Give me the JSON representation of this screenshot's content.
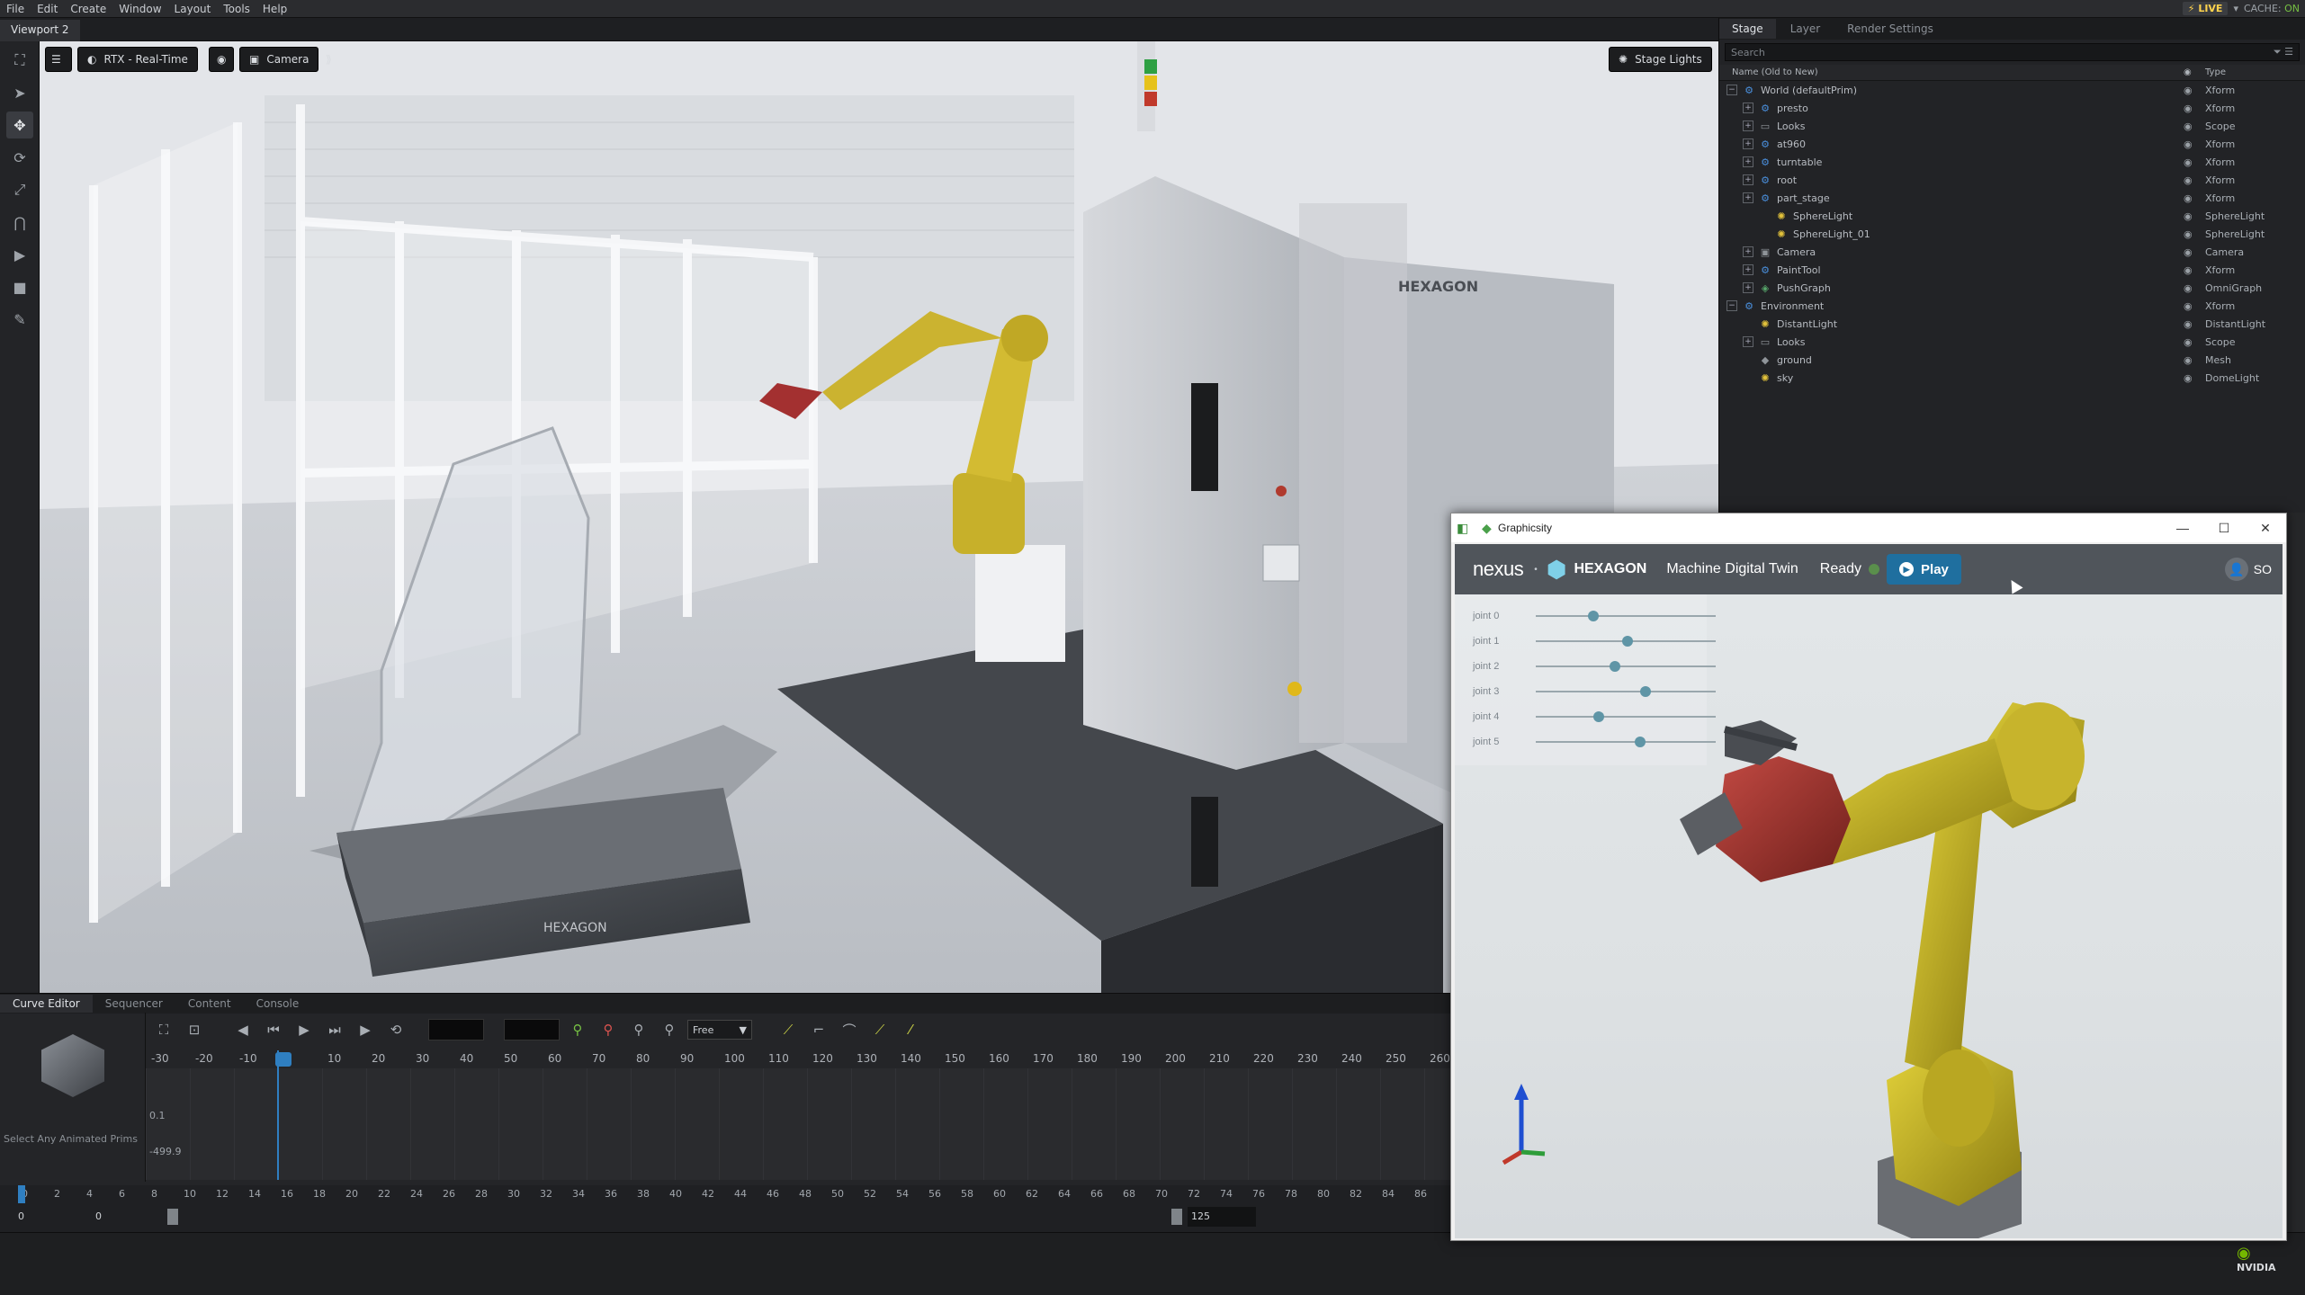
{
  "menubar": {
    "items": [
      "File",
      "Edit",
      "Create",
      "Window",
      "Layout",
      "Tools",
      "Help"
    ],
    "live_label": "LIVE",
    "cache_label": "CACHE:",
    "cache_value": "ON"
  },
  "viewport": {
    "tab_label": "Viewport 2",
    "renderer_label": "RTX - Real-Time",
    "camera_label": "Camera",
    "stage_lights_label": "Stage Lights",
    "hexagon_wall_label": "HEXAGON",
    "hexagon_cart_label": "HEXAGON"
  },
  "stage_panel": {
    "tabs": [
      "Stage",
      "Layer",
      "Render Settings"
    ],
    "search_placeholder": "Search",
    "col_name": "Name (Old to New)",
    "col_type": "Type",
    "rows": [
      {
        "name": "World (defaultPrim)",
        "type": "Xform",
        "depth": 0,
        "expander": "−",
        "icon": "xform"
      },
      {
        "name": "presto",
        "type": "Xform",
        "depth": 1,
        "expander": "+",
        "icon": "xform"
      },
      {
        "name": "Looks",
        "type": "Scope",
        "depth": 1,
        "expander": "+",
        "icon": "scope"
      },
      {
        "name": "at960",
        "type": "Xform",
        "depth": 1,
        "expander": "+",
        "icon": "xform"
      },
      {
        "name": "turntable",
        "type": "Xform",
        "depth": 1,
        "expander": "+",
        "icon": "xform"
      },
      {
        "name": "root",
        "type": "Xform",
        "depth": 1,
        "expander": "+",
        "icon": "xform"
      },
      {
        "name": "part_stage",
        "type": "Xform",
        "depth": 1,
        "expander": "+",
        "icon": "xform"
      },
      {
        "name": "SphereLight",
        "type": "SphereLight",
        "depth": 2,
        "expander": "",
        "icon": "light"
      },
      {
        "name": "SphereLight_01",
        "type": "SphereLight",
        "depth": 2,
        "expander": "",
        "icon": "light"
      },
      {
        "name": "Camera",
        "type": "Camera",
        "depth": 1,
        "expander": "+",
        "icon": "camera"
      },
      {
        "name": "PaintTool",
        "type": "Xform",
        "depth": 1,
        "expander": "+",
        "icon": "xform"
      },
      {
        "name": "PushGraph",
        "type": "OmniGraph",
        "depth": 1,
        "expander": "+",
        "icon": "graph"
      },
      {
        "name": "Environment",
        "type": "Xform",
        "depth": 0,
        "expander": "−",
        "icon": "xform"
      },
      {
        "name": "DistantLight",
        "type": "DistantLight",
        "depth": 1,
        "expander": "",
        "icon": "light"
      },
      {
        "name": "Looks",
        "type": "Scope",
        "depth": 1,
        "expander": "+",
        "icon": "scope"
      },
      {
        "name": "ground",
        "type": "Mesh",
        "depth": 1,
        "expander": "",
        "icon": "mesh"
      },
      {
        "name": "sky",
        "type": "DomeLight",
        "depth": 1,
        "expander": "",
        "icon": "light"
      }
    ]
  },
  "bottom": {
    "tabs": [
      "Curve Editor",
      "Sequencer",
      "Content",
      "Console"
    ],
    "thumb_caption": "Select Any Animated Prims",
    "interp_select": "Free",
    "ruler_labels": [
      "-30",
      "-20",
      "-10",
      "0",
      "10",
      "20",
      "30",
      "40",
      "50",
      "60",
      "70",
      "80",
      "90",
      "100",
      "110",
      "120",
      "130",
      "140",
      "150",
      "160",
      "170",
      "180",
      "190",
      "200",
      "210",
      "220",
      "230",
      "240",
      "250",
      "260"
    ],
    "y_labels": [
      "0.1",
      "-499.9"
    ],
    "timeline_labels": [
      "0",
      "2",
      "4",
      "6",
      "8",
      "10",
      "12",
      "14",
      "16",
      "18",
      "20",
      "22",
      "24",
      "26",
      "28",
      "30",
      "32",
      "34",
      "36",
      "38",
      "40",
      "42",
      "44",
      "46",
      "48",
      "50",
      "52",
      "54",
      "56",
      "58",
      "60",
      "62",
      "64",
      "66",
      "68",
      "70",
      "72",
      "74",
      "76",
      "78",
      "80",
      "82",
      "84",
      "86"
    ],
    "range_start": "0",
    "range_start2": "0",
    "range_end": "125",
    "nvidia_label": "NVIDIA"
  },
  "graphicsity": {
    "window_title": "Graphicsity",
    "brand_nexus": "nexus",
    "brand_hexagon": "HEXAGON",
    "app_name": "Machine Digital Twin",
    "status": "Ready",
    "play_label": "Play",
    "user_initials": "SO",
    "joints": [
      {
        "label": "joint 0",
        "value": 0.32
      },
      {
        "label": "joint 1",
        "value": 0.51
      },
      {
        "label": "joint 2",
        "value": 0.44
      },
      {
        "label": "joint 3",
        "value": 0.61
      },
      {
        "label": "joint 4",
        "value": 0.35
      },
      {
        "label": "joint 5",
        "value": 0.58
      }
    ]
  }
}
